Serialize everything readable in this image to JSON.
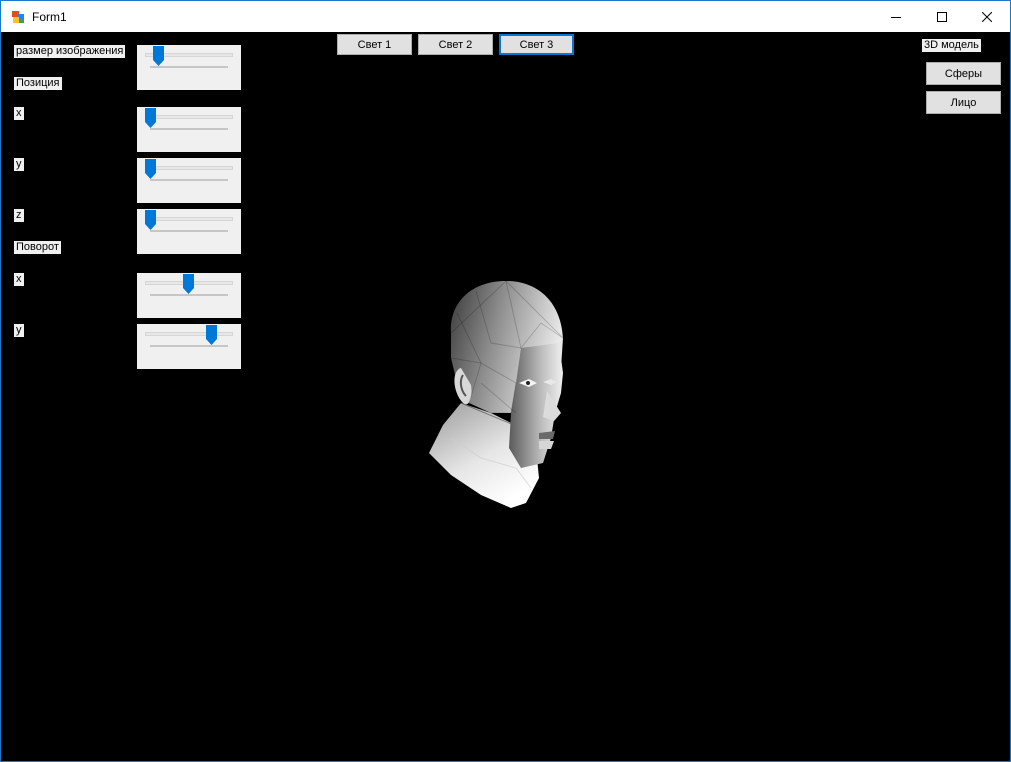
{
  "window": {
    "title": "Form1",
    "accent": "#0078d7",
    "background": "#000000"
  },
  "titlebar_controls": [
    {
      "name": "minimize",
      "icon": "minimize-icon"
    },
    {
      "name": "maximize",
      "icon": "maximize-icon"
    },
    {
      "name": "close",
      "icon": "close-icon"
    }
  ],
  "left_panel": {
    "size_label": "размер изображения",
    "position_label": "Позиция",
    "pos_x_label": "x",
    "pos_y_label": "y",
    "pos_z_label": "z",
    "rotation_label": "Поворот",
    "rot_x_label": "x",
    "rot_y_label": "y"
  },
  "sliders": {
    "size": 0.1,
    "pos_x": 0.0,
    "pos_y": 0.0,
    "pos_z": 0.0,
    "rot_x": 0.5,
    "rot_y": 0.8
  },
  "lights": {
    "light1": "Свет 1",
    "light2": "Свет 2",
    "light3": "Свет 3"
  },
  "model": {
    "label": "3D модель",
    "spheres": "Сферы",
    "face": "Лицо"
  }
}
